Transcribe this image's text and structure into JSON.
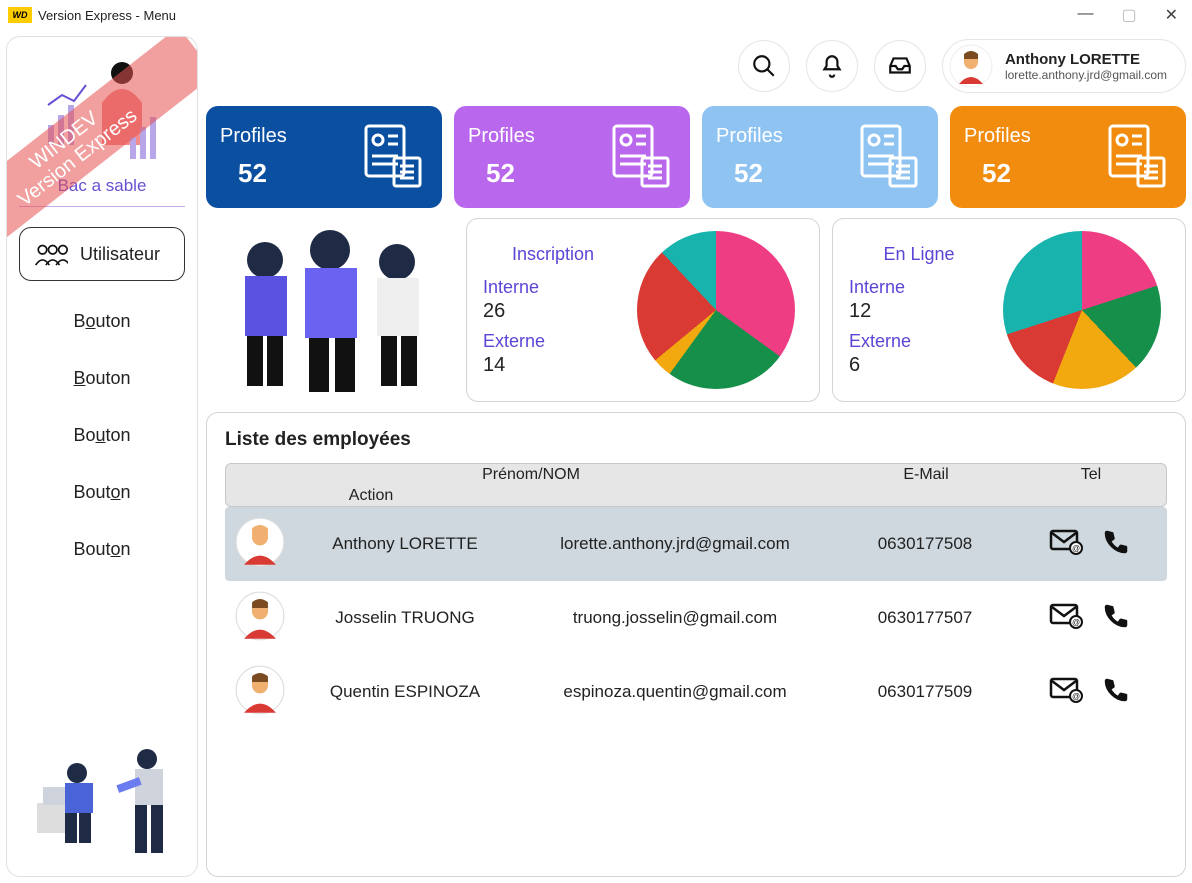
{
  "window": {
    "title": "Version Express - Menu"
  },
  "ribbon": {
    "line1": "WINDEV",
    "line2": "Version Express"
  },
  "sidebar": {
    "title": "Bac a sable",
    "user_btn": "Utilisateur",
    "buttons": [
      "Bouton",
      "Bouton",
      "Bouton",
      "Bouton",
      "Bouton"
    ],
    "btn_underline_idx": [
      1,
      0,
      2,
      4,
      4
    ]
  },
  "header": {
    "user_name": "Anthony LORETTE",
    "user_email": "lorette.anthony.jrd@gmail.com"
  },
  "cards": [
    {
      "label": "Profiles",
      "value": "52"
    },
    {
      "label": "Profiles",
      "value": "52"
    },
    {
      "label": "Profiles",
      "value": "52"
    },
    {
      "label": "Profiles",
      "value": "52"
    }
  ],
  "panels": {
    "inscription": {
      "title": "Inscription",
      "interne_label": "Interne",
      "interne_value": "26",
      "externe_label": "Externe",
      "externe_value": "14"
    },
    "enligne": {
      "title": "En Ligne",
      "interne_label": "Interne",
      "interne_value": "12",
      "externe_label": "Externe",
      "externe_value": "6"
    }
  },
  "chart_data": [
    {
      "type": "pie",
      "title": "Inscription",
      "series": [
        {
          "name": "Rose",
          "value": 35,
          "color": "#ef3d84"
        },
        {
          "name": "Vert",
          "value": 25,
          "color": "#158f49"
        },
        {
          "name": "Jaune",
          "value": 4,
          "color": "#f2a80f"
        },
        {
          "name": "Rouge",
          "value": 24,
          "color": "#d93a33"
        },
        {
          "name": "Cyan",
          "value": 12,
          "color": "#17b3ac"
        }
      ]
    },
    {
      "type": "pie",
      "title": "En Ligne",
      "series": [
        {
          "name": "Rose",
          "value": 20,
          "color": "#ef3d84"
        },
        {
          "name": "Vert",
          "value": 18,
          "color": "#158f49"
        },
        {
          "name": "Jaune",
          "value": 18,
          "color": "#f2a80f"
        },
        {
          "name": "Rouge",
          "value": 14,
          "color": "#d93a33"
        },
        {
          "name": "Cyan",
          "value": 30,
          "color": "#17b3ac"
        }
      ]
    }
  ],
  "table": {
    "title": "Liste des employées",
    "headers": {
      "name": "Prénom/NOM",
      "email": "E-Mail",
      "tel": "Tel",
      "action": "Action"
    },
    "rows": [
      {
        "name": "Anthony LORETTE",
        "email": "lorette.anthony.jrd@gmail.com",
        "tel": "0630177508",
        "selected": true
      },
      {
        "name": "Josselin TRUONG",
        "email": "truong.josselin@gmail.com",
        "tel": "0630177507",
        "selected": false
      },
      {
        "name": "Quentin ESPINOZA",
        "email": "espinoza.quentin@gmail.com",
        "tel": "0630177509",
        "selected": false
      }
    ]
  }
}
